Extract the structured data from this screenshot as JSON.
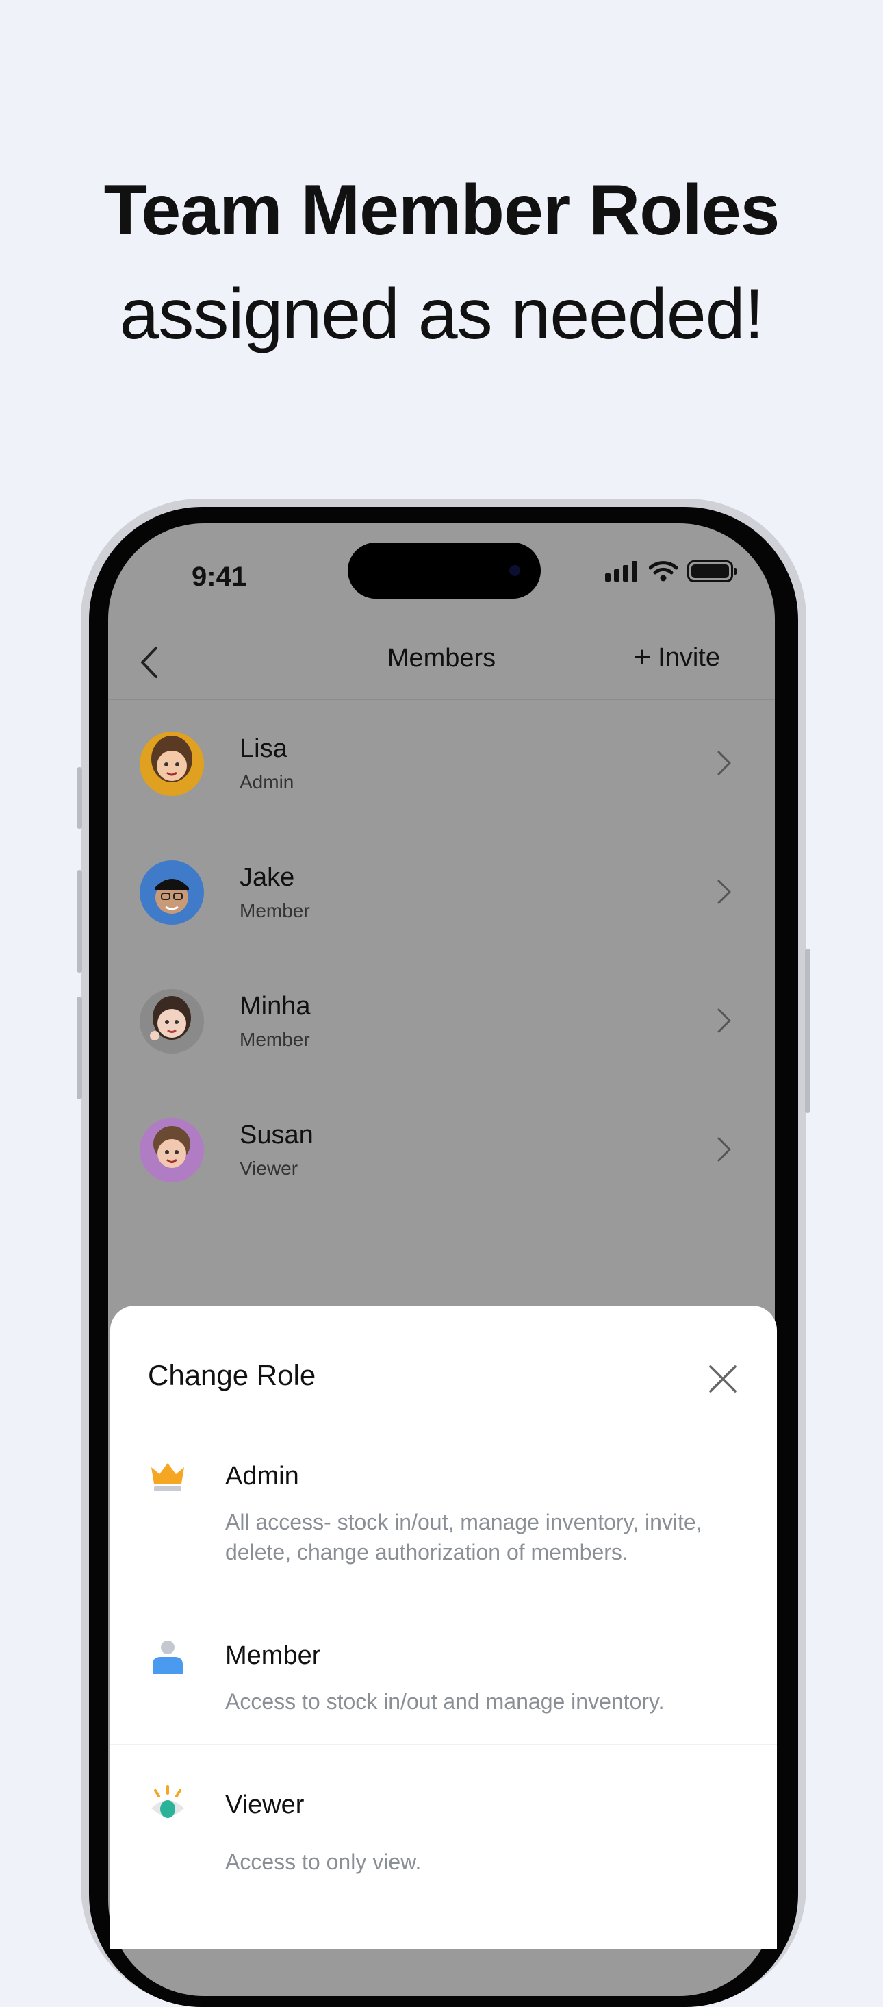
{
  "headline": {
    "bold": "Team Member Roles",
    "light": "assigned as needed!"
  },
  "status_bar": {
    "time": "9:41"
  },
  "nav": {
    "title": "Members",
    "invite_label": "Invite"
  },
  "members": [
    {
      "name": "Lisa",
      "role": "Admin",
      "avatar_color": "#e0a020"
    },
    {
      "name": "Jake",
      "role": "Member",
      "avatar_color": "#3f7bc9"
    },
    {
      "name": "Minha",
      "role": "Member",
      "avatar_color": "#8a8a8a"
    },
    {
      "name": "Susan",
      "role": "Viewer",
      "avatar_color": "#b07cc4"
    }
  ],
  "sheet": {
    "title": "Change Role",
    "roles": [
      {
        "name": "Admin",
        "description": "All access- stock in/out, manage inventory, invite, delete, change authorization of members.",
        "icon": "crown-icon"
      },
      {
        "name": "Member",
        "description": "Access to stock in/out and manage inventory.",
        "icon": "person-icon"
      },
      {
        "name": "Viewer",
        "description": "Access to only view.",
        "icon": "eye-icon"
      }
    ]
  },
  "colors": {
    "background": "#eff2f9",
    "overlay": "#9a9a9a",
    "admin_crown": "#f5a623",
    "member_blue": "#4a9af0",
    "viewer_teal": "#2bb39a"
  }
}
